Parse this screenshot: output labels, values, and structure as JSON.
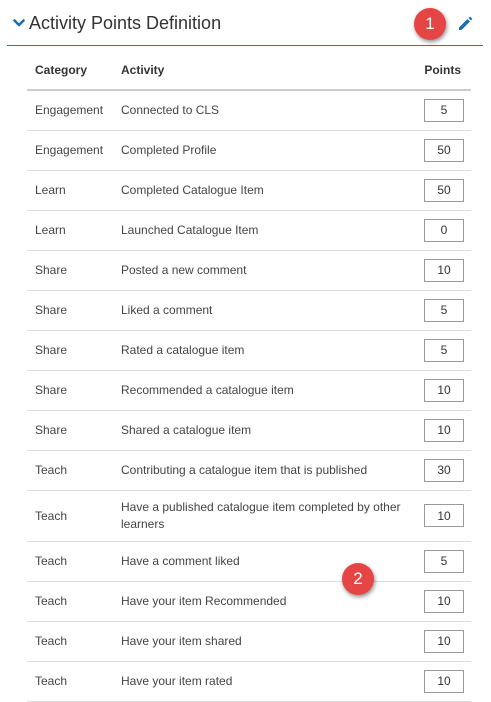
{
  "panel": {
    "title": "Activity Points Definition",
    "accent_color": "#1a6fb4"
  },
  "callouts": [
    "1",
    "2"
  ],
  "table": {
    "headers": {
      "category": "Category",
      "activity": "Activity",
      "points": "Points"
    },
    "rows": [
      {
        "category": "Engagement",
        "activity": "Connected to CLS",
        "points": "5"
      },
      {
        "category": "Engagement",
        "activity": "Completed Profile",
        "points": "50"
      },
      {
        "category": "Learn",
        "activity": "Completed Catalogue Item",
        "points": "50"
      },
      {
        "category": "Learn",
        "activity": "Launched Catalogue Item",
        "points": "0"
      },
      {
        "category": "Share",
        "activity": "Posted a new comment",
        "points": "10"
      },
      {
        "category": "Share",
        "activity": "Liked a comment",
        "points": "5"
      },
      {
        "category": "Share",
        "activity": "Rated a catalogue item",
        "points": "5"
      },
      {
        "category": "Share",
        "activity": "Recommended a catalogue item",
        "points": "10"
      },
      {
        "category": "Share",
        "activity": "Shared a catalogue item",
        "points": "10"
      },
      {
        "category": "Teach",
        "activity": "Contributing a catalogue item that is published",
        "points": "30"
      },
      {
        "category": "Teach",
        "activity": "Have a published catalogue item completed by other learners",
        "points": "10"
      },
      {
        "category": "Teach",
        "activity": "Have a comment liked",
        "points": "5"
      },
      {
        "category": "Teach",
        "activity": "Have your item Recommended",
        "points": "10"
      },
      {
        "category": "Teach",
        "activity": "Have your item shared",
        "points": "10"
      },
      {
        "category": "Teach",
        "activity": "Have your item rated",
        "points": "10"
      }
    ]
  },
  "icons": {
    "collapse": "chevron-down-icon",
    "edit": "pencil-icon"
  }
}
